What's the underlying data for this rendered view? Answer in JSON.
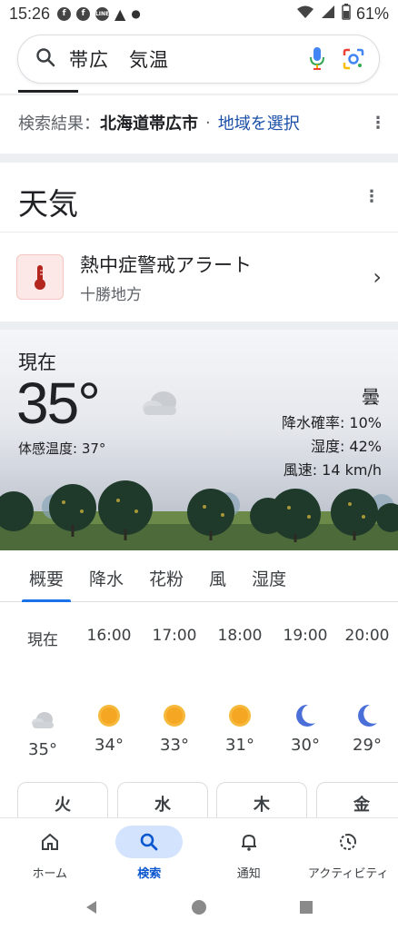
{
  "status": {
    "time": "15:26",
    "battery": "61%"
  },
  "search": {
    "query": "帯広　気温"
  },
  "result": {
    "prefix": "検索結果：",
    "location": "北海道帯広市",
    "dot": "·",
    "select_region": "地域を選択"
  },
  "weather": {
    "title": "天気",
    "alert": {
      "title": "熱中症警戒アラート",
      "subtitle": "十勝地方"
    },
    "now_label": "現在",
    "temperature": "35°",
    "feels_like": "体感温度: 37°",
    "condition": "曇",
    "precip": "降水確率: 10%",
    "humidity": "湿度: 42%",
    "wind": "風速: 14 km/h"
  },
  "tabs": [
    "概要",
    "降水",
    "花粉",
    "風",
    "湿度"
  ],
  "hourly": [
    {
      "time": "現在",
      "icon": "cloud-icon",
      "temp": "35°"
    },
    {
      "time": "16:00",
      "icon": "sun-icon",
      "temp": "34°"
    },
    {
      "time": "17:00",
      "icon": "sun-icon",
      "temp": "33°"
    },
    {
      "time": "18:00",
      "icon": "sun-icon",
      "temp": "31°"
    },
    {
      "time": "19:00",
      "icon": "moon-icon",
      "temp": "30°"
    },
    {
      "time": "20:00",
      "icon": "moon-icon",
      "temp": "29°"
    }
  ],
  "days": [
    "火",
    "水",
    "木",
    "金"
  ],
  "nav": {
    "home": "ホーム",
    "search": "検索",
    "notify": "通知",
    "activity": "アクティビティ"
  },
  "colors": {
    "accent": "#1a73e8",
    "link": "#1a4fa8",
    "sun": "#f5a623",
    "moon": "#4a6fd8"
  }
}
